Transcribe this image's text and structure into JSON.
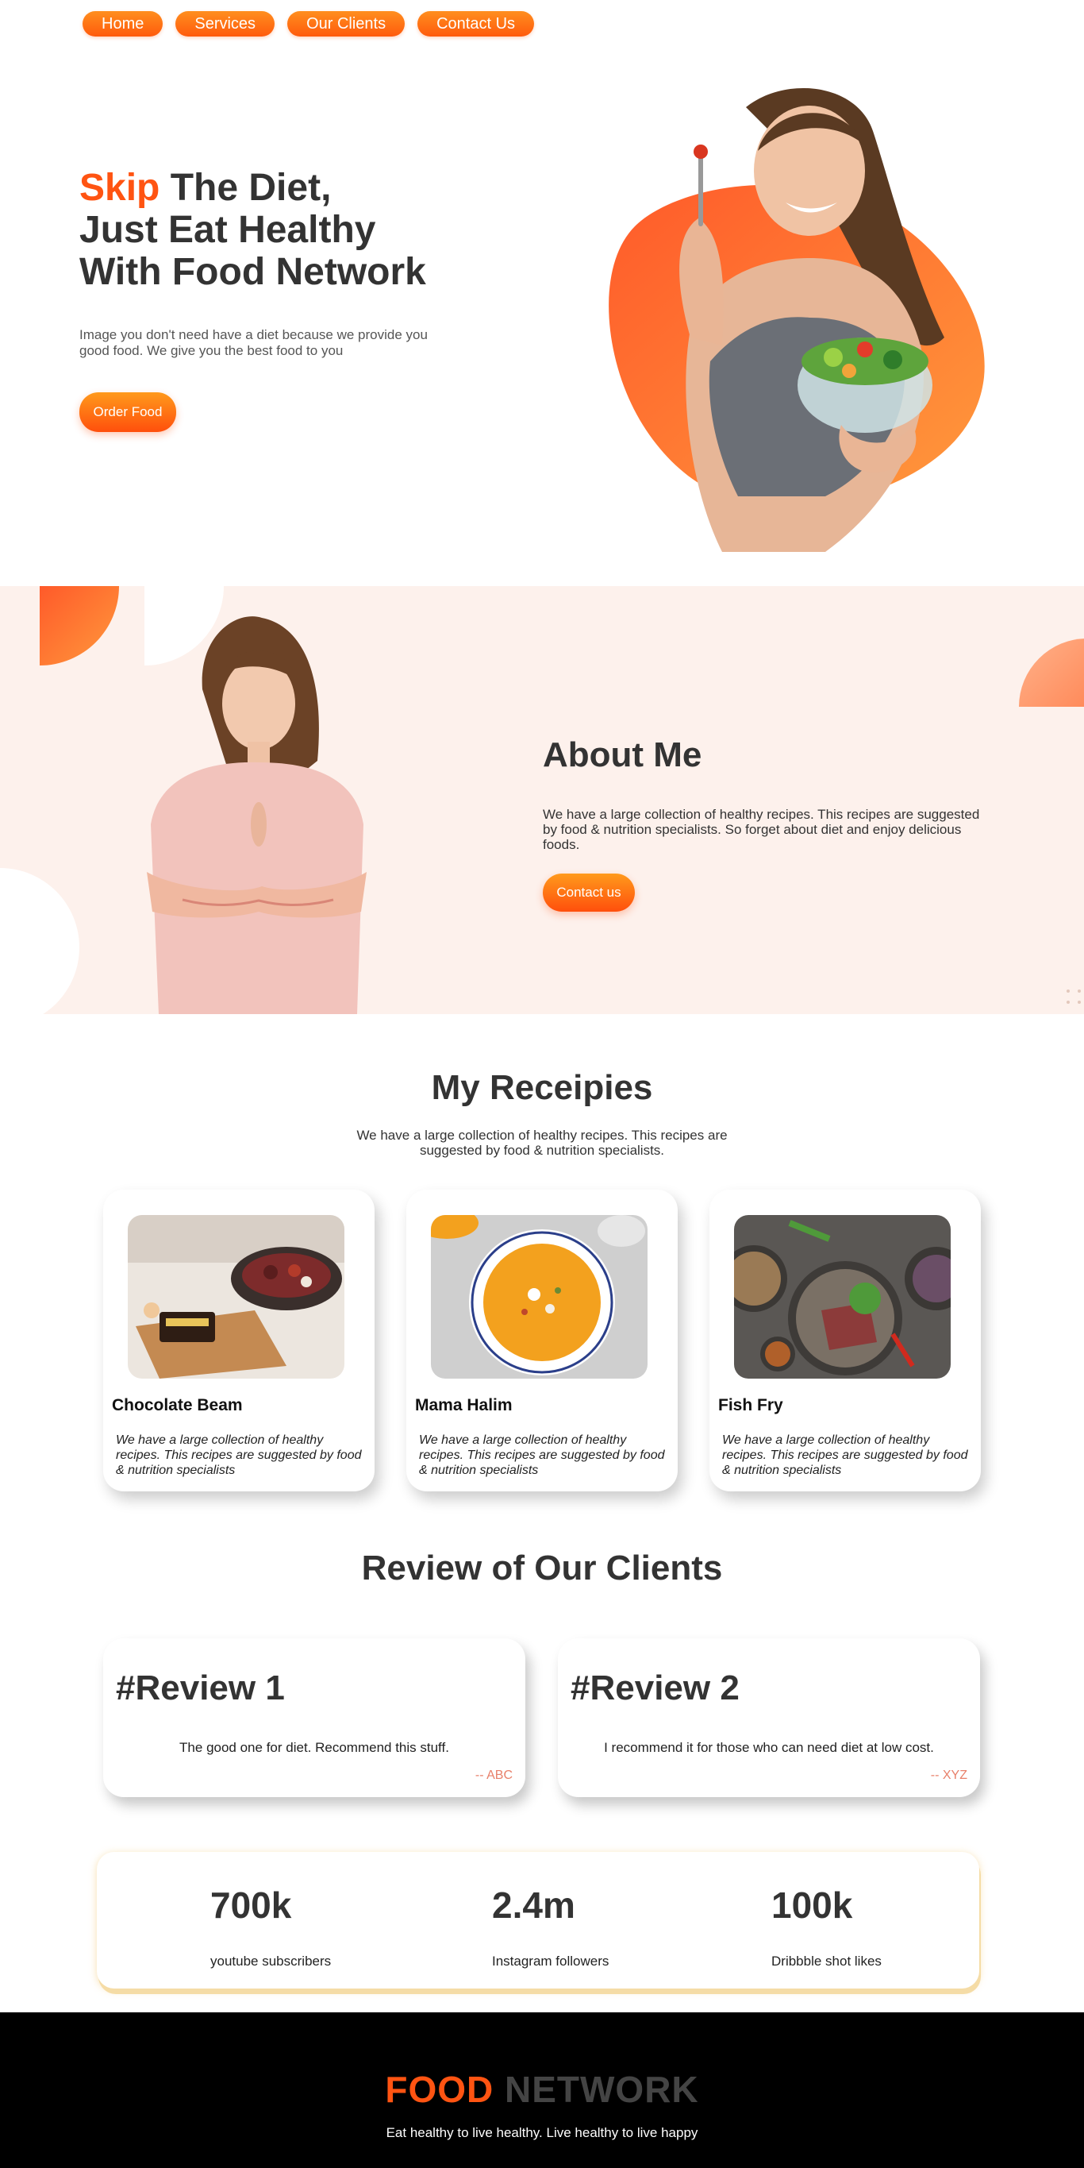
{
  "nav": {
    "items": [
      {
        "label": "Home"
      },
      {
        "label": "Services"
      },
      {
        "label": "Our Clients"
      },
      {
        "label": "Contact Us"
      }
    ]
  },
  "hero": {
    "title_accent": "Skip",
    "title_line1_rest": " The Diet,",
    "title_line2": "Just Eat Healthy",
    "title_line3": "With Food Network",
    "description": "Image you don't need have a diet because we provide you good food. We give you the best food to you",
    "cta_label": "Order Food"
  },
  "about": {
    "title": "About Me",
    "description": "We have a large collection of healthy recipes. This recipes are suggested by food & nutrition specialists. So forget about diet and enjoy delicious foods.",
    "cta_label": "Contact us"
  },
  "recipes": {
    "title": "My Receipies",
    "subtitle": "We have a large collection of healthy recipes. This recipes are suggested by food & nutrition specialists.",
    "items": [
      {
        "name": "Chocolate Beam",
        "description": "We have a large collection of healthy recipes. This recipes are suggested by food & nutrition specialists"
      },
      {
        "name": "Mama Halim",
        "description": "We have a large collection of healthy recipes. This recipes are suggested by food & nutrition specialists"
      },
      {
        "name": "Fish Fry",
        "description": "We have a large collection of healthy recipes. This recipes are suggested by food & nutrition specialists"
      }
    ]
  },
  "reviews": {
    "title": "Review of Our Clients",
    "items": [
      {
        "heading": "#Review 1",
        "text": "The good one for diet. Recommend this stuff.",
        "author": "-- ABC"
      },
      {
        "heading": "#Review 2",
        "text": "I recommend it for those who can need diet at low cost.",
        "author": "-- XYZ"
      }
    ]
  },
  "stats": {
    "items": [
      {
        "value": "700k",
        "label": "youtube subscribers"
      },
      {
        "value": "2.4m",
        "label": "Instagram followers"
      },
      {
        "value": "100k",
        "label": "Dribbble shot likes"
      }
    ]
  },
  "footer": {
    "brand_part1": "FOOD",
    "brand_part2": " NETWORK",
    "tagline": "Eat healthy to live healthy. Live healthy to live happy"
  },
  "colors": {
    "accent": "#ff5412",
    "accent_light": "#ff9a1c",
    "about_bg": "#fdf1ec",
    "footer_bg": "#000000",
    "stats_border": "#f5dca6"
  }
}
